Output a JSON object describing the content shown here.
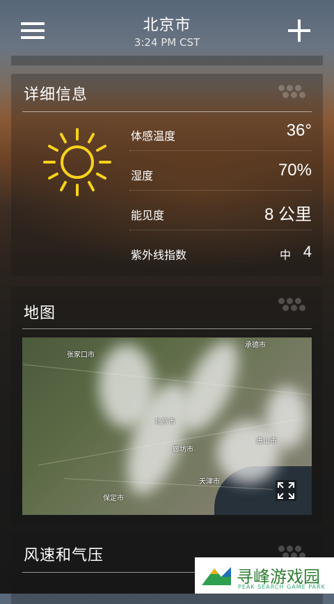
{
  "header": {
    "city": "北京市",
    "time": "3:24 PM CST"
  },
  "details": {
    "title": "详细信息",
    "weather_icon": "sun-icon",
    "rows": [
      {
        "label": "体感温度",
        "value": "36°"
      },
      {
        "label": "湿度",
        "value": "70%"
      },
      {
        "label": "能见度",
        "value": "8 公里"
      },
      {
        "label": "紫外线指数",
        "level": "中",
        "value": "4"
      }
    ]
  },
  "map": {
    "title": "地图",
    "labels": [
      "张家口市",
      "承德市",
      "北京市",
      "廊坊市",
      "唐山市",
      "天津市",
      "保定市"
    ]
  },
  "wind": {
    "title": "风速和气压"
  },
  "watermark": {
    "title": "寻峰游戏园",
    "subtitle": "PEAK SEARCH GAME PARK"
  },
  "colors": {
    "sun": "#f8d21a",
    "watermark_green": "#2e7d32"
  }
}
